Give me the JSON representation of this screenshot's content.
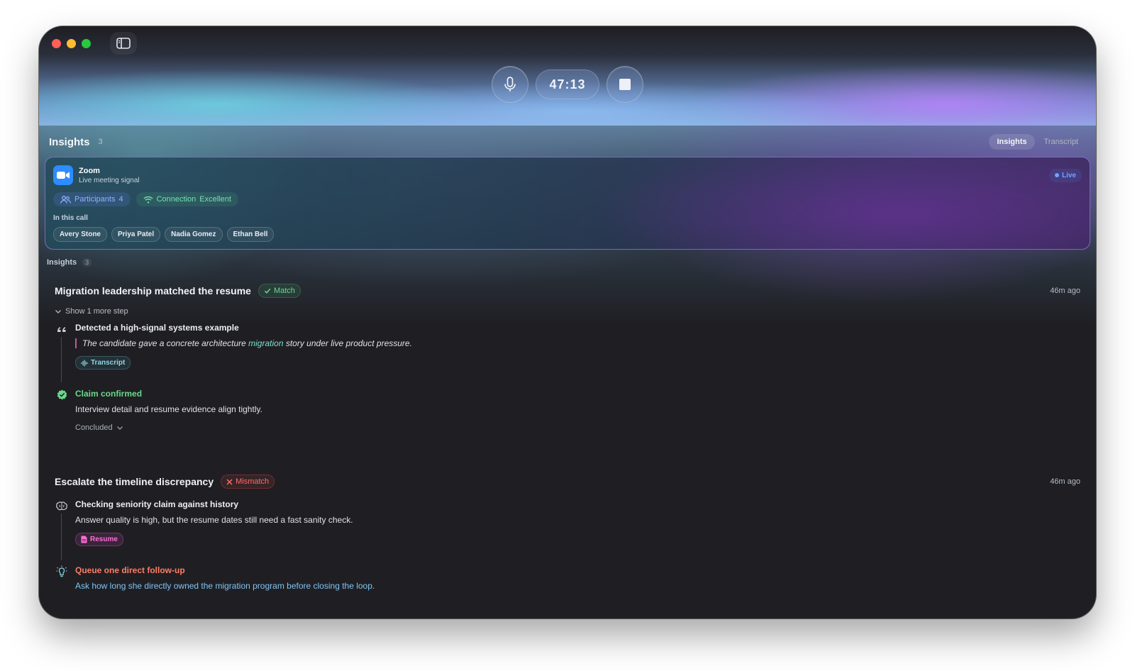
{
  "window": {
    "timer": "47:13"
  },
  "header": {
    "title": "Insights",
    "count": "3",
    "tabs": [
      {
        "label": "Insights",
        "active": true
      },
      {
        "label": "Transcript",
        "active": false
      }
    ]
  },
  "meeting": {
    "app_name": "Zoom",
    "subtitle": "Live meeting signal",
    "status": "Live",
    "participants_label": "Participants",
    "participants_count": "4",
    "connection_label": "Connection",
    "connection_value": "Excellent",
    "in_call_label": "In this call",
    "people": [
      "Avery Stone",
      "Priya Patel",
      "Nadia Gomez",
      "Ethan Bell"
    ]
  },
  "insights_section": {
    "label": "Insights",
    "count": "3"
  },
  "insights": [
    {
      "title": "Migration leadership matched the resume",
      "badge": "Match",
      "time": "46m ago",
      "show_more": "Show 1 more step",
      "step1": {
        "title": "Detected a high-signal systems example",
        "quote_pre": "The candidate gave a concrete architecture ",
        "quote_hl": "migration",
        "quote_post": " story under live product pressure.",
        "source": "Transcript"
      },
      "step2": {
        "title": "Claim confirmed",
        "body": "Interview detail and resume evidence align tightly.",
        "status": "Concluded"
      }
    },
    {
      "title": "Escalate the timeline discrepancy",
      "badge": "Mismatch",
      "time": "46m ago",
      "step1": {
        "title": "Checking seniority claim against history",
        "body": "Answer quality is high, but the resume dates still need a fast sanity check.",
        "source": "Resume"
      },
      "step2": {
        "title": "Queue one direct follow-up",
        "body": "Ask how long she directly owned the migration program before closing the loop."
      }
    }
  ],
  "colors": {
    "match": "#6ad88a",
    "mismatch": "#ff6b6b",
    "live": "#6fa4ff",
    "zoom_blue": "#2d8cff",
    "resume_pink": "#ff6ed8",
    "followup_coral": "#ff7d66"
  },
  "icons": [
    "sidebar-toggle-icon",
    "microphone-icon",
    "stop-icon",
    "video-camera-icon",
    "users-icon",
    "wifi-icon",
    "chevron-down-icon",
    "quote-icon",
    "waveform-icon",
    "check-badge-icon",
    "brain-icon",
    "document-icon",
    "lightbulb-icon",
    "check-icon",
    "x-icon"
  ]
}
